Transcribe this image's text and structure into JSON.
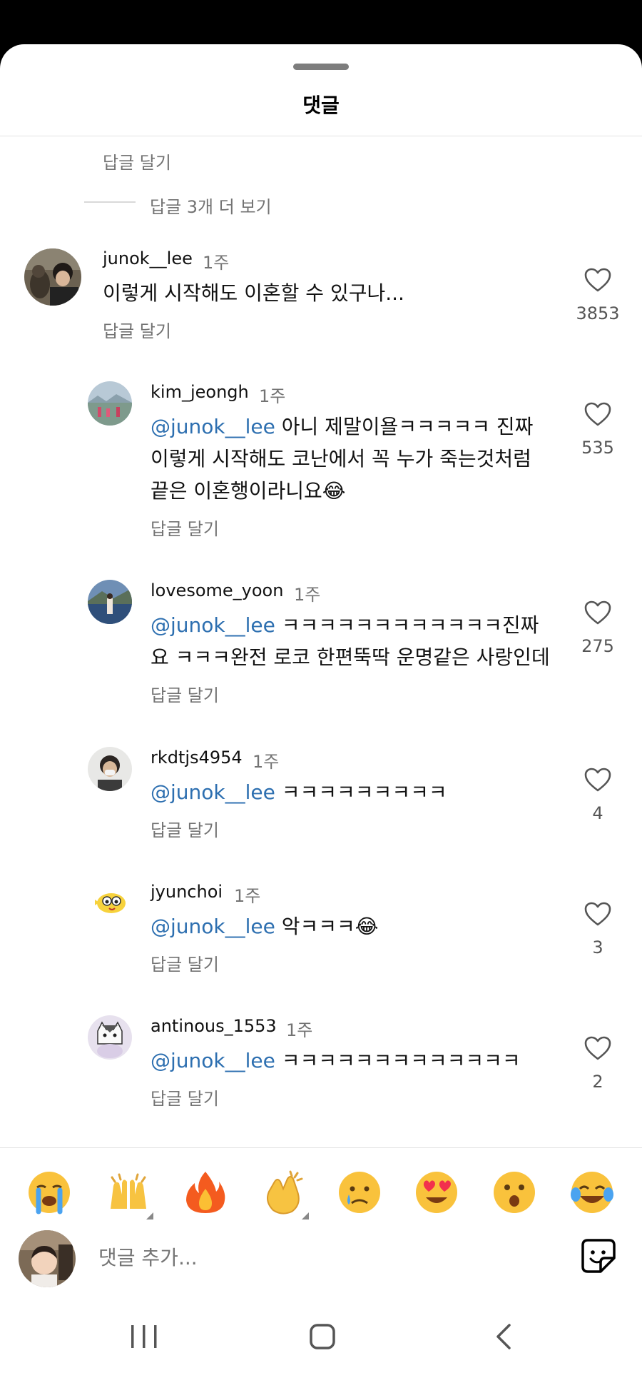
{
  "header": {
    "title": "댓글"
  },
  "top_reply_label": "답글 달기",
  "more_replies_label": "답글 3개 더 보기",
  "comments": [
    {
      "username": "junok__lee",
      "time": "1주",
      "text": "이렇게 시작해도 이혼할 수 있구나...",
      "likes": "3853",
      "reply_label": "답글 달기"
    },
    {
      "username": "kim_jeongh",
      "time": "1주",
      "mention": "@junok__lee",
      "text": " 아니 제말이욜ㅋㅋㅋㅋㅋ 진짜 이렇게 시작해도 코난에서 꼭 누가 죽는것처럼 끝은 이혼행이라니요😂",
      "likes": "535",
      "reply_label": "답글 달기"
    },
    {
      "username": "lovesome_yoon",
      "time": "1주",
      "mention": "@junok__lee",
      "text": " ㅋㅋㅋㅋㅋㅋㅋㅋㅋㅋㅋㅋ진짜요 ㅋㅋㅋ완전 로코 한편뚝딱 운명같은 사랑인데",
      "likes": "275",
      "reply_label": "답글 달기"
    },
    {
      "username": "rkdtjs4954",
      "time": "1주",
      "mention": "@junok__lee",
      "text": " ㅋㅋㅋㅋㅋㅋㅋㅋㅋ",
      "likes": "4",
      "reply_label": "답글 달기"
    },
    {
      "username": "jyunchoi",
      "time": "1주",
      "mention": "@junok__lee",
      "text": " 악ㅋㅋㅋ😂",
      "likes": "3",
      "reply_label": "답글 달기"
    },
    {
      "username": "antinous_1553",
      "time": "1주",
      "mention": "@junok__lee",
      "text": " ㅋㅋㅋㅋㅋㅋㅋㅋㅋㅋㅋㅋㅋ",
      "likes": "2",
      "reply_label": "답글 달기"
    }
  ],
  "emoji_bar": [
    "loudly-crying-face",
    "raising-hands",
    "fire",
    "clapping-hands",
    "crying-face",
    "heart-eyes-face",
    "surprised-face",
    "tears-of-joy-face"
  ],
  "composer": {
    "placeholder": "댓글 추가..."
  },
  "colors": {
    "mention": "#2d6fb0",
    "muted": "#737373"
  }
}
